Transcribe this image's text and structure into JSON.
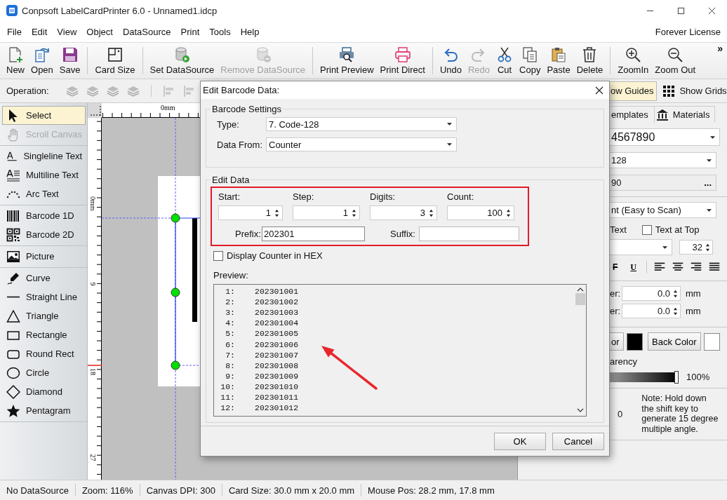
{
  "window": {
    "title": "Conpsoft LabelCardPrinter 6.0 - Unnamed1.idcp"
  },
  "menu": {
    "items": [
      "File",
      "Edit",
      "View",
      "Object",
      "DataSource",
      "Print",
      "Tools",
      "Help"
    ],
    "license": "Forever License"
  },
  "toolbar": {
    "groups": [
      [
        {
          "label": "New",
          "disabled": false
        },
        {
          "label": "Open",
          "disabled": false
        },
        {
          "label": "Save",
          "disabled": false
        }
      ],
      [
        {
          "label": "Card Size",
          "disabled": false
        }
      ],
      [
        {
          "label": "Set DataSource",
          "disabled": false
        },
        {
          "label": "Remove DataSource",
          "disabled": true
        }
      ],
      [
        {
          "label": "Print Preview",
          "disabled": false
        },
        {
          "label": "Print Direct",
          "disabled": false
        }
      ],
      [
        {
          "label": "Undo",
          "disabled": false
        },
        {
          "label": "Redo",
          "disabled": true
        },
        {
          "label": "Cut",
          "disabled": false
        },
        {
          "label": "Copy",
          "disabled": false
        },
        {
          "label": "Paste",
          "disabled": false
        },
        {
          "label": "Delete",
          "disabled": false
        }
      ],
      [
        {
          "label": "ZoomIn",
          "disabled": false
        },
        {
          "label": "Zoom Out",
          "disabled": false
        }
      ]
    ],
    "overflow": "»"
  },
  "operation_bar": {
    "label": "Operation:",
    "toggles": [
      {
        "label": "ow Guides",
        "selected": true
      },
      {
        "label": "Show Grids",
        "selected": false
      }
    ]
  },
  "tools": {
    "groups": [
      [
        {
          "label": "Select",
          "selected": true,
          "disabled": false
        },
        {
          "label": "Scroll Canvas",
          "selected": false,
          "disabled": true
        }
      ],
      [
        {
          "label": "Singleline Text",
          "selected": false,
          "disabled": false
        },
        {
          "label": "Multiline Text",
          "selected": false,
          "disabled": false
        },
        {
          "label": "Arc Text",
          "selected": false,
          "disabled": false
        }
      ],
      [
        {
          "label": "Barcode 1D",
          "selected": false,
          "disabled": false
        },
        {
          "label": "Barcode 2D",
          "selected": false,
          "disabled": false
        }
      ],
      [
        {
          "label": "Picture",
          "selected": false,
          "disabled": false
        }
      ],
      [
        {
          "label": "Curve",
          "selected": false,
          "disabled": false
        },
        {
          "label": "Straight Line",
          "selected": false,
          "disabled": false
        },
        {
          "label": "Triangle",
          "selected": false,
          "disabled": false
        },
        {
          "label": "Rectangle",
          "selected": false,
          "disabled": false
        },
        {
          "label": "Round Rect",
          "selected": false,
          "disabled": false
        },
        {
          "label": "Circle",
          "selected": false,
          "disabled": false
        },
        {
          "label": "Diamond",
          "selected": false,
          "disabled": false
        },
        {
          "label": "Pentagram",
          "selected": false,
          "disabled": false
        }
      ]
    ]
  },
  "canvas": {
    "h_ruler_label": "0mm",
    "v_ruler_labels": [
      "0mm",
      "9",
      "18",
      "27"
    ]
  },
  "right_panel": {
    "tabs": [
      "emplates",
      "Materials"
    ],
    "data_dropdown": "4567890",
    "type_dropdown": "128",
    "data_field": "90",
    "more_button": "...",
    "text_style_dropdown": "nt (Easy to Scan)",
    "show_text_label": "Text",
    "text_at_top": {
      "label": "Text at Top",
      "checked": false
    },
    "font_size": "32",
    "style_buttons": [
      "F",
      "U"
    ],
    "offsets": [
      {
        "label": "er:",
        "value": "0.0",
        "unit": "mm"
      },
      {
        "label": "er:",
        "value": "0.0",
        "unit": "mm"
      }
    ],
    "color_buttons": [
      {
        "label": "or",
        "color": "#000000"
      },
      {
        "label": "Back Color",
        "color": "#ffffff"
      }
    ],
    "transparency_label": "arency",
    "transparency": {
      "level": 1,
      "reading": "100%"
    },
    "rotation": "0",
    "note": "Note: Hold down the shift key to generate 15 degree multiple angle."
  },
  "dialog": {
    "title": "Edit Barcode Data:",
    "settings": {
      "title": "Barcode Settings",
      "type_label": "Type:",
      "type": "7.  Code-128",
      "data_from_label": "Data From:",
      "data_from": "Counter"
    },
    "edit": {
      "title": "Edit Data",
      "spinners": [
        {
          "label": "Start:",
          "value": "1"
        },
        {
          "label": "Step:",
          "value": "1"
        },
        {
          "label": "Digits:",
          "value": "3"
        },
        {
          "label": "Count:",
          "value": "100"
        }
      ],
      "prefix_label": "Prefix:",
      "prefix": "202301",
      "suffix_label": "Suffix:",
      "hex": {
        "label": "Display Counter in HEX",
        "checked": false
      },
      "preview_label": "Preview:",
      "preview": [
        {
          "index": "1:",
          "value": "202301001"
        },
        {
          "index": "2:",
          "value": "202301002"
        },
        {
          "index": "3:",
          "value": "202301003"
        },
        {
          "index": "4:",
          "value": "202301004"
        },
        {
          "index": "5:",
          "value": "202301005"
        },
        {
          "index": "6:",
          "value": "202301006"
        },
        {
          "index": "7:",
          "value": "202301007"
        },
        {
          "index": "8:",
          "value": "202301008"
        },
        {
          "index": "9:",
          "value": "202301009"
        },
        {
          "index": "10:",
          "value": "202301010"
        },
        {
          "index": "11:",
          "value": "202301011"
        },
        {
          "index": "12:",
          "value": "202301012"
        }
      ]
    },
    "buttons": [
      "OK",
      "Cancel"
    ]
  },
  "status_bar": [
    "No DataSource",
    "Zoom: 116%",
    "Canvas DPI: 300",
    "Card Size: 30.0 mm x 20.0 mm",
    "Mouse Pos: 28.2 mm, 17.8 mm"
  ]
}
